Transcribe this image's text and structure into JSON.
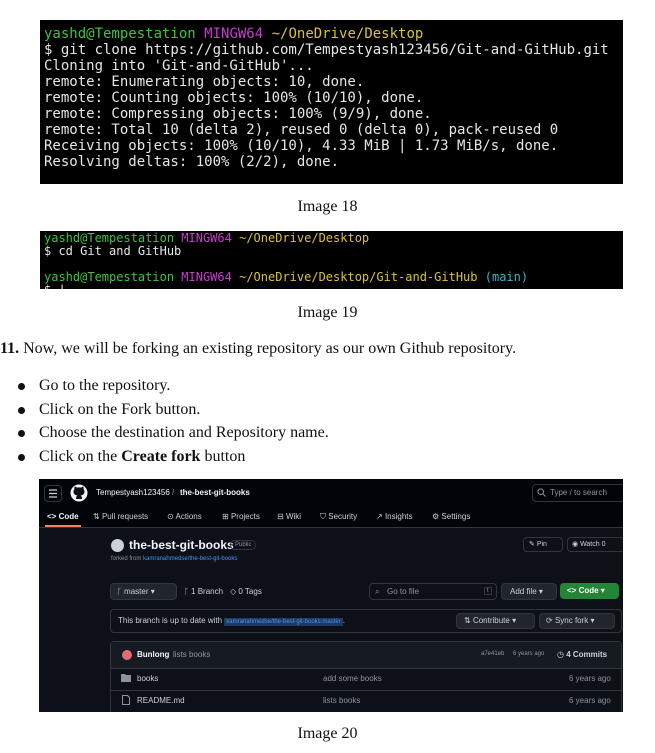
{
  "terminal1": {
    "prompt_user": "yashd@Tempestation",
    "prompt_env": "MINGW64",
    "prompt_path": "~/OneDrive/Desktop",
    "lines": [
      "$ git clone https://github.com/Tempestyash123456/Git-and-GitHub.git",
      "Cloning into 'Git-and-GitHub'...",
      "remote: Enumerating objects: 10, done.",
      "remote: Counting objects: 100% (10/10), done.",
      "remote: Compressing objects: 100% (9/9), done.",
      "remote: Total 10 (delta 2), reused 0 (delta 0), pack-reused 0",
      "Receiving objects: 100% (10/10), 4.33 MiB | 1.73 MiB/s, done.",
      "Resolving deltas: 100% (2/2), done."
    ]
  },
  "caption1": "Image 18",
  "terminal2": {
    "prompt1_user": "yashd@Tempestation",
    "prompt1_env": "MINGW64",
    "prompt1_path": "~/OneDrive/Desktop",
    "cmd": "$ cd Git and GitHub",
    "prompt2_user": "yashd@Tempestation",
    "prompt2_env": "MINGW64",
    "prompt2_path": "~/OneDrive/Desktop/Git-and-GitHub",
    "prompt2_branch": "(main)",
    "cursor": "$ |"
  },
  "caption2": "Image 19",
  "step": {
    "number": "11.",
    "text": "Now, we will be forking an existing repository as our own Github repository."
  },
  "bullets": [
    {
      "text": "Go to the repository.",
      "bold": ""
    },
    {
      "text": "Click on the Fork button.",
      "bold": ""
    },
    {
      "text": "Choose the destination and Repository name.",
      "bold": ""
    },
    {
      "text": "Click on the ",
      "bold": "Create fork",
      "after": " button"
    }
  ],
  "github": {
    "owner": "Tempestyash123456",
    "sep": "/",
    "repo": "the-best-git-books",
    "search_placeholder": "Type / to search",
    "tabs": [
      "Code",
      "Pull requests",
      "Actions",
      "Projects",
      "Wiki",
      "Security",
      "Insights",
      "Settings"
    ],
    "repo_title": "the-best-git-books",
    "visibility": "Public",
    "forked_from_label": "forked from",
    "forked_from": "kamranahmedse/the-best-git-books",
    "pin": "Pin",
    "watch": "Watch",
    "watch_count": "0",
    "branch": "master",
    "branches": "1 Branch",
    "tags": "0 Tags",
    "go_to_file": "Go to file",
    "go_key": "t",
    "add_file": "Add file",
    "code_btn": "Code",
    "uptodate_text": "This branch is up to date with",
    "uptodate_ref": "kamranahmedse/the-best-git-books:master",
    "uptodate_end": ".",
    "contribute": "Contribute",
    "sync_fork": "Sync fork",
    "commit_author": "Bunlong",
    "commit_msg": "lists books",
    "commit_hash": "a7e41eb",
    "commit_age": "6 years ago",
    "commits": "4 Commits",
    "files": [
      {
        "name": "books",
        "msg": "add some books",
        "age": "6 years ago",
        "icon": "folder-icon"
      },
      {
        "name": "README.md",
        "msg": "lists books",
        "age": "6 years ago",
        "icon": "file-icon"
      }
    ]
  },
  "caption3": "Image 20"
}
